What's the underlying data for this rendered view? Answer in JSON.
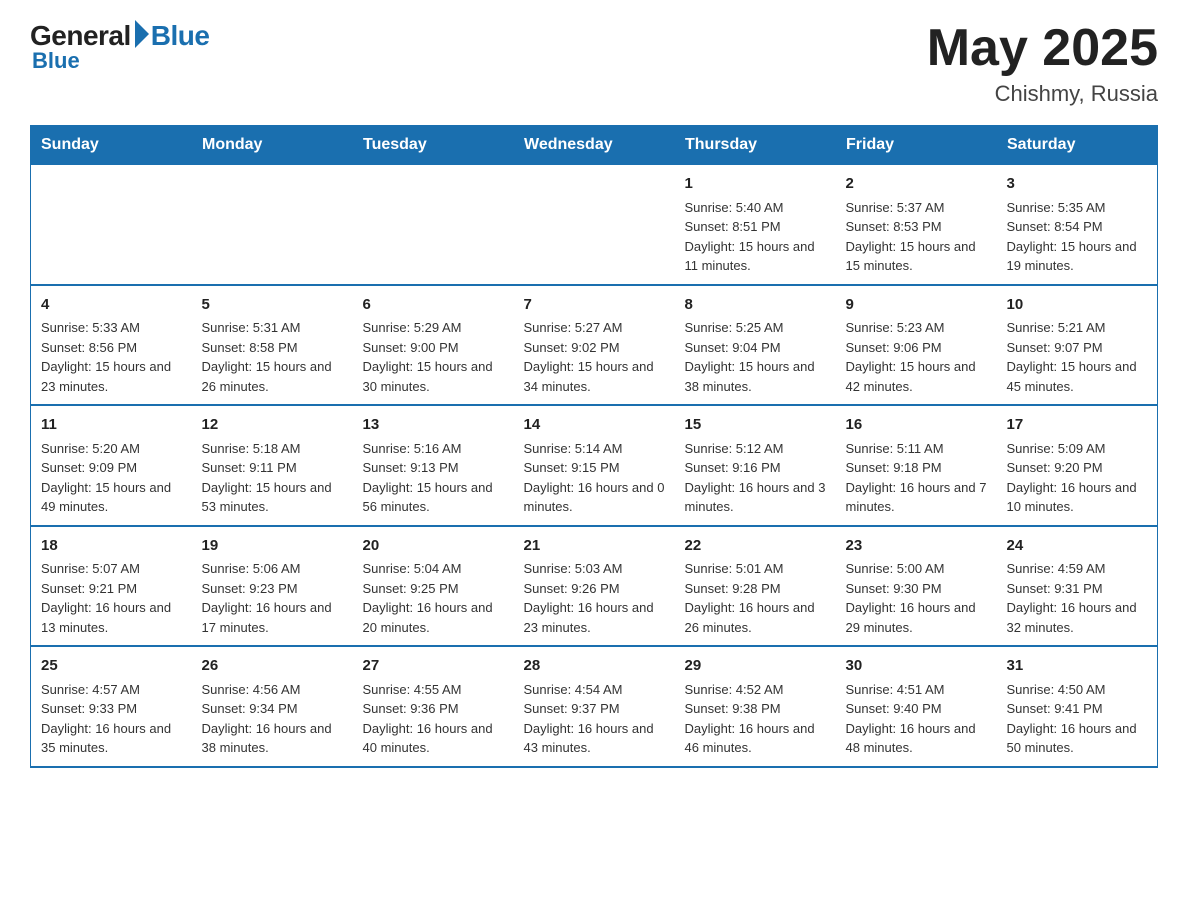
{
  "logo": {
    "general": "General",
    "blue": "Blue"
  },
  "title": {
    "month_year": "May 2025",
    "location": "Chishmy, Russia"
  },
  "weekdays": [
    "Sunday",
    "Monday",
    "Tuesday",
    "Wednesday",
    "Thursday",
    "Friday",
    "Saturday"
  ],
  "weeks": [
    [
      {
        "day": "",
        "info": ""
      },
      {
        "day": "",
        "info": ""
      },
      {
        "day": "",
        "info": ""
      },
      {
        "day": "",
        "info": ""
      },
      {
        "day": "1",
        "info": "Sunrise: 5:40 AM\nSunset: 8:51 PM\nDaylight: 15 hours and 11 minutes."
      },
      {
        "day": "2",
        "info": "Sunrise: 5:37 AM\nSunset: 8:53 PM\nDaylight: 15 hours and 15 minutes."
      },
      {
        "day": "3",
        "info": "Sunrise: 5:35 AM\nSunset: 8:54 PM\nDaylight: 15 hours and 19 minutes."
      }
    ],
    [
      {
        "day": "4",
        "info": "Sunrise: 5:33 AM\nSunset: 8:56 PM\nDaylight: 15 hours and 23 minutes."
      },
      {
        "day": "5",
        "info": "Sunrise: 5:31 AM\nSunset: 8:58 PM\nDaylight: 15 hours and 26 minutes."
      },
      {
        "day": "6",
        "info": "Sunrise: 5:29 AM\nSunset: 9:00 PM\nDaylight: 15 hours and 30 minutes."
      },
      {
        "day": "7",
        "info": "Sunrise: 5:27 AM\nSunset: 9:02 PM\nDaylight: 15 hours and 34 minutes."
      },
      {
        "day": "8",
        "info": "Sunrise: 5:25 AM\nSunset: 9:04 PM\nDaylight: 15 hours and 38 minutes."
      },
      {
        "day": "9",
        "info": "Sunrise: 5:23 AM\nSunset: 9:06 PM\nDaylight: 15 hours and 42 minutes."
      },
      {
        "day": "10",
        "info": "Sunrise: 5:21 AM\nSunset: 9:07 PM\nDaylight: 15 hours and 45 minutes."
      }
    ],
    [
      {
        "day": "11",
        "info": "Sunrise: 5:20 AM\nSunset: 9:09 PM\nDaylight: 15 hours and 49 minutes."
      },
      {
        "day": "12",
        "info": "Sunrise: 5:18 AM\nSunset: 9:11 PM\nDaylight: 15 hours and 53 minutes."
      },
      {
        "day": "13",
        "info": "Sunrise: 5:16 AM\nSunset: 9:13 PM\nDaylight: 15 hours and 56 minutes."
      },
      {
        "day": "14",
        "info": "Sunrise: 5:14 AM\nSunset: 9:15 PM\nDaylight: 16 hours and 0 minutes."
      },
      {
        "day": "15",
        "info": "Sunrise: 5:12 AM\nSunset: 9:16 PM\nDaylight: 16 hours and 3 minutes."
      },
      {
        "day": "16",
        "info": "Sunrise: 5:11 AM\nSunset: 9:18 PM\nDaylight: 16 hours and 7 minutes."
      },
      {
        "day": "17",
        "info": "Sunrise: 5:09 AM\nSunset: 9:20 PM\nDaylight: 16 hours and 10 minutes."
      }
    ],
    [
      {
        "day": "18",
        "info": "Sunrise: 5:07 AM\nSunset: 9:21 PM\nDaylight: 16 hours and 13 minutes."
      },
      {
        "day": "19",
        "info": "Sunrise: 5:06 AM\nSunset: 9:23 PM\nDaylight: 16 hours and 17 minutes."
      },
      {
        "day": "20",
        "info": "Sunrise: 5:04 AM\nSunset: 9:25 PM\nDaylight: 16 hours and 20 minutes."
      },
      {
        "day": "21",
        "info": "Sunrise: 5:03 AM\nSunset: 9:26 PM\nDaylight: 16 hours and 23 minutes."
      },
      {
        "day": "22",
        "info": "Sunrise: 5:01 AM\nSunset: 9:28 PM\nDaylight: 16 hours and 26 minutes."
      },
      {
        "day": "23",
        "info": "Sunrise: 5:00 AM\nSunset: 9:30 PM\nDaylight: 16 hours and 29 minutes."
      },
      {
        "day": "24",
        "info": "Sunrise: 4:59 AM\nSunset: 9:31 PM\nDaylight: 16 hours and 32 minutes."
      }
    ],
    [
      {
        "day": "25",
        "info": "Sunrise: 4:57 AM\nSunset: 9:33 PM\nDaylight: 16 hours and 35 minutes."
      },
      {
        "day": "26",
        "info": "Sunrise: 4:56 AM\nSunset: 9:34 PM\nDaylight: 16 hours and 38 minutes."
      },
      {
        "day": "27",
        "info": "Sunrise: 4:55 AM\nSunset: 9:36 PM\nDaylight: 16 hours and 40 minutes."
      },
      {
        "day": "28",
        "info": "Sunrise: 4:54 AM\nSunset: 9:37 PM\nDaylight: 16 hours and 43 minutes."
      },
      {
        "day": "29",
        "info": "Sunrise: 4:52 AM\nSunset: 9:38 PM\nDaylight: 16 hours and 46 minutes."
      },
      {
        "day": "30",
        "info": "Sunrise: 4:51 AM\nSunset: 9:40 PM\nDaylight: 16 hours and 48 minutes."
      },
      {
        "day": "31",
        "info": "Sunrise: 4:50 AM\nSunset: 9:41 PM\nDaylight: 16 hours and 50 minutes."
      }
    ]
  ]
}
